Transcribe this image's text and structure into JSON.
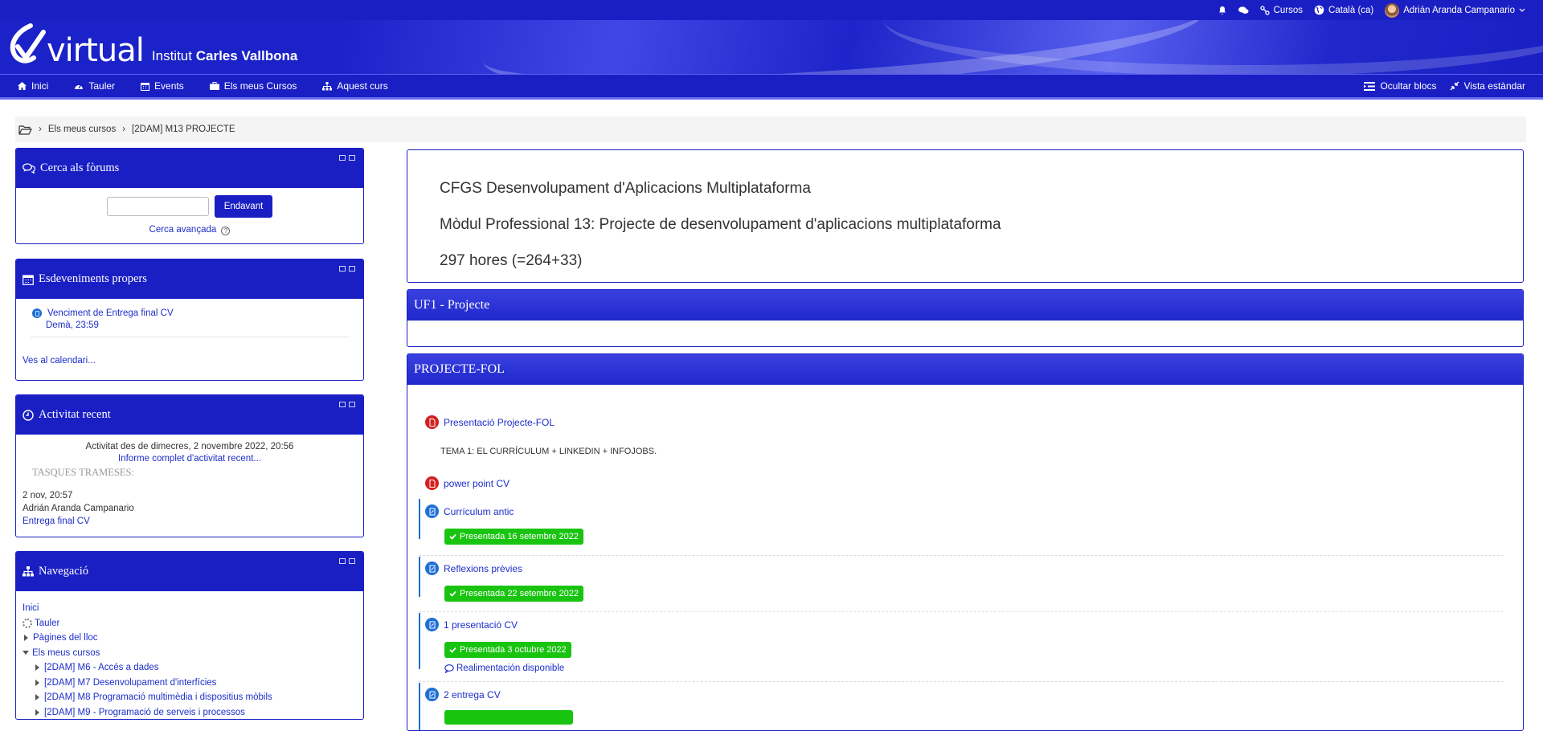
{
  "topbar": {
    "courses": "Cursos",
    "language": "Català (ca)",
    "user": "Adrián Aranda Campanario"
  },
  "banner": {
    "logo_word": "virtual",
    "inst_prefix": "Institut",
    "inst_name": "Carles Vallbona"
  },
  "nav": {
    "items": [
      "Inici",
      "Tauler",
      "Events",
      "Els meus Cursos",
      "Aquest curs"
    ],
    "hide_blocks": "Ocultar blocs",
    "standard_view": "Vista estàndar"
  },
  "breadcrumb": {
    "items": [
      "Els meus cursos",
      "[2DAM] M13 PROJECTE"
    ]
  },
  "forum_search": {
    "title": "Cerca als fòrums",
    "input_value": "",
    "button": "Endavant",
    "advanced": "Cerca avançada"
  },
  "events": {
    "title": "Esdeveniments propers",
    "event_name": "Venciment de Entrega final CV",
    "event_when": "Demà, 23:59",
    "calendar_link": "Ves al calendari..."
  },
  "recent": {
    "title": "Activitat recent",
    "since": "Activitat des de dimecres, 2 novembre 2022, 20:56",
    "full_report": "Informe complet d'activitat recent...",
    "section": "TASQUES TRAMESES:",
    "date": "2 nov, 20:57",
    "user": "Adrián Aranda Campanario",
    "link": "Entrega final CV"
  },
  "navigation": {
    "title": "Navegació",
    "items": {
      "home": "Inici",
      "dashboard": "Tauler",
      "site_pages": "Pàgines del lloc",
      "my_courses": "Els meus cursos",
      "c1": "[2DAM] M6 - Accés a dades",
      "c2": "[2DAM] M7 Desenvolupament d'interfícies",
      "c3": "[2DAM] M8 Programació multimèdia i dispositius mòbils",
      "c4": "[2DAM] M9 - Programació de serveis i processos"
    }
  },
  "intro": {
    "line1": "CFGS Desenvolupament d'Aplicacions Multiplataforma",
    "line2": "Mòdul Professional 13: Projecte de desenvolupament d'aplicacions multiplataforma",
    "line3": "297 hores (=264+33)"
  },
  "sections": {
    "uf1": "UF1 - Projecte",
    "fol": "PROJECTE-FOL"
  },
  "fol": {
    "a1": "Presentació Projecte-FOL",
    "label": "TEMA 1: EL CURRÍCULUM + LINKEDIN + INFOJOBS.",
    "a2": "power point CV",
    "a3": "Currículum antic",
    "b3": "Presentada 16 setembre 2022",
    "a4": "Reflexions prèvies",
    "b4": "Presentada 22 setembre 2022",
    "a5": "1 presentació CV",
    "b5": "Presentada 3 octubre 2022",
    "fb5": "Realimentación disponible",
    "a6": "2 entrega CV"
  },
  "colors": {
    "primary": "#1a1fc4",
    "success": "#19c411",
    "pdf": "#d42020",
    "assign": "#1f6fd6"
  }
}
